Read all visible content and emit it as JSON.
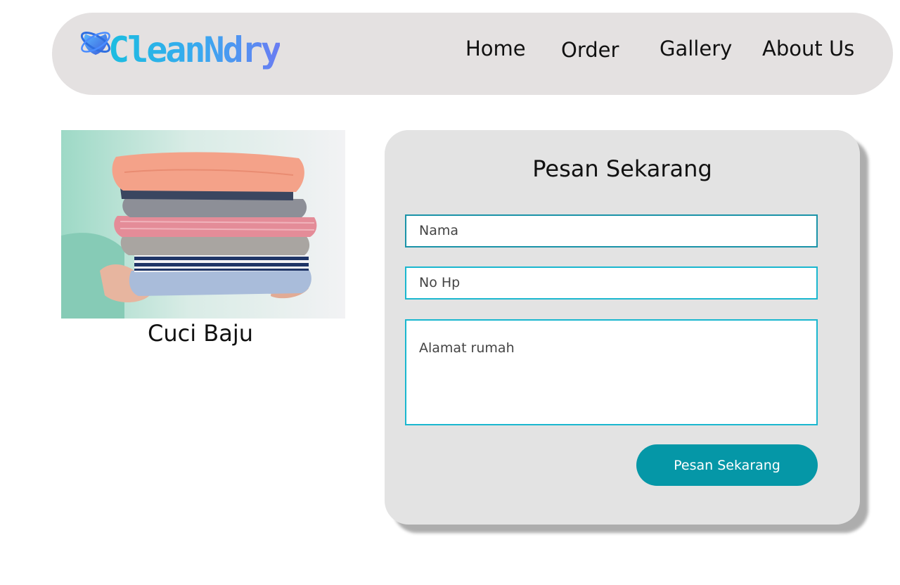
{
  "header": {
    "logo_text": "CleanNdry",
    "logo_icon": "globe-ring-icon",
    "nav": [
      "Home",
      "Order",
      "Gallery",
      "About Us"
    ]
  },
  "service": {
    "image": "folded-clothes-stack",
    "caption": "Cuci Baju"
  },
  "order_form": {
    "title": "Pesan Sekarang",
    "name_placeholder": "Nama",
    "phone_placeholder": "No Hp",
    "address_placeholder": "Alamat rumah",
    "submit_label": "Pesan Sekarang"
  },
  "colors": {
    "nav_background": "#e4e1e1",
    "card_background": "#e3e3e3",
    "accent": "#0597a7",
    "field_border": "#1ab7cf",
    "logo_gradient": [
      "#1bbde0",
      "#6a7cf2"
    ]
  }
}
